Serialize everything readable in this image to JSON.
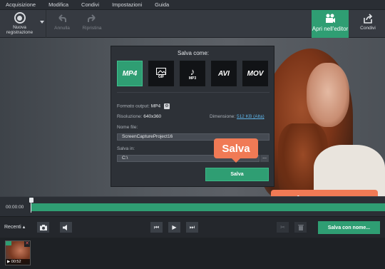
{
  "menu": [
    "Acquisizione",
    "Modifica",
    "Condivi",
    "Impostazioni",
    "Guida"
  ],
  "toolbar": {
    "record_label": "Nuova registrazione",
    "undo_label": "Annulla",
    "redo_label": "Ripristina",
    "editor_label": "Apri nell'editor",
    "share_label": "Condivi"
  },
  "dialog": {
    "title": "Salva come:",
    "formats": [
      {
        "label": "MP4",
        "selected": true
      },
      {
        "label": "GIF",
        "selected": false
      },
      {
        "label": "MP3",
        "selected": false
      },
      {
        "label": "AVI",
        "selected": false
      },
      {
        "label": "MOV",
        "selected": false
      }
    ],
    "output_format_label": "Formato output:",
    "output_format_value": "MP4",
    "resolution_label": "Risoluzione:",
    "resolution_value": "640x360",
    "size_label": "Dimensione:",
    "size_value": "512 KB (Alta)",
    "filename_label": "Nome file:",
    "filename_value": "ScreenCaptureProject16",
    "savein_label": "Salva in:",
    "savein_value": "C:\\",
    "browse_label": "...",
    "save_button": "Salva"
  },
  "tooltips": {
    "save": "Salva",
    "save_as": "Salva con nome"
  },
  "timeline": {
    "time": "00:00:00"
  },
  "controls": {
    "recent_label": "Recenti",
    "save_as_button": "Salva con nome..."
  },
  "recents": {
    "items": [
      {
        "duration": "00:52"
      }
    ]
  },
  "colors": {
    "accent": "#2f9e73",
    "tooltip": "#f07a55",
    "link": "#5eb3e6"
  }
}
